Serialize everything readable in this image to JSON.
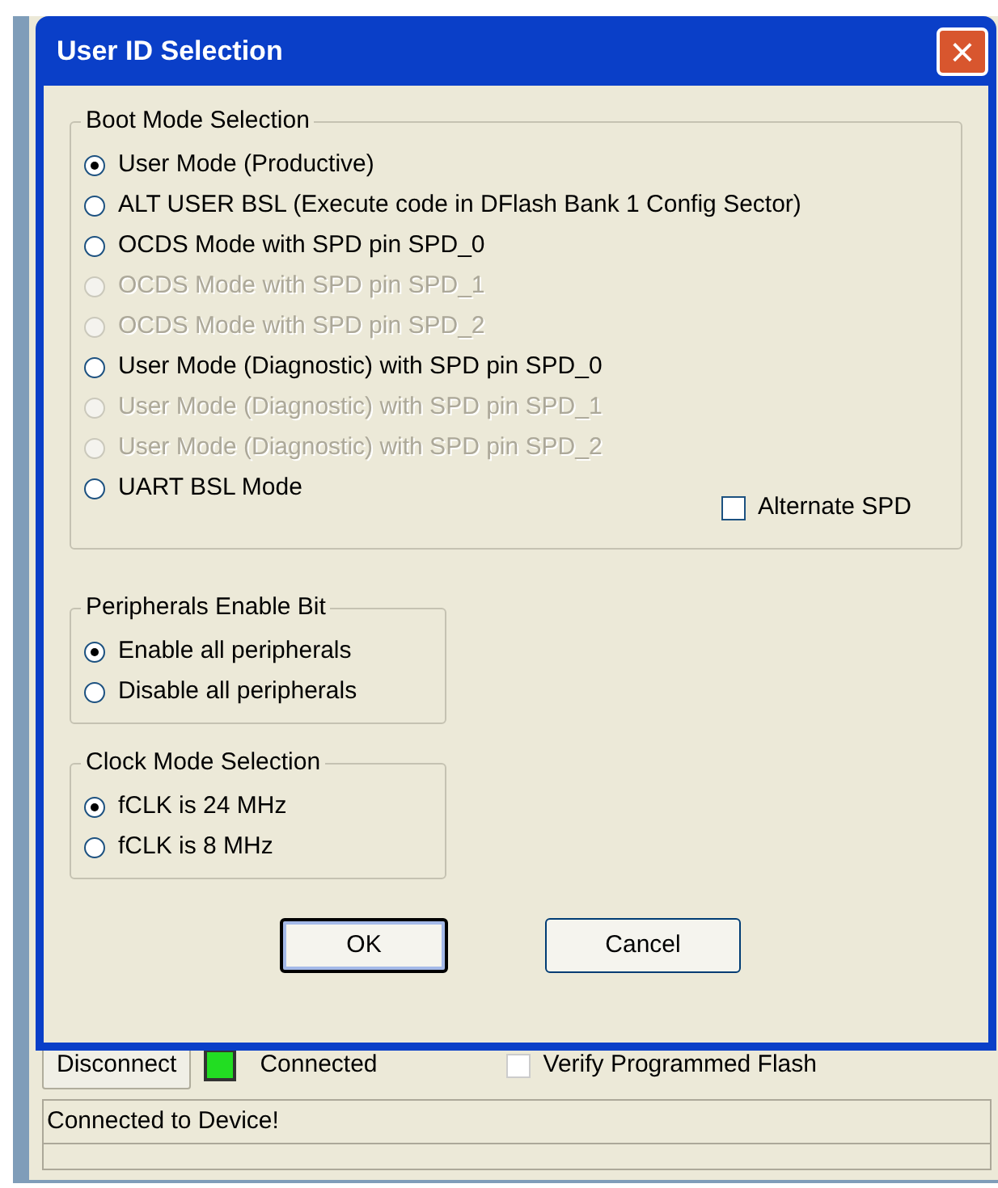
{
  "dialog": {
    "title": "User ID Selection",
    "close": "×"
  },
  "boot_mode": {
    "title": "Boot Mode Selection",
    "options": [
      {
        "label": "User Mode (Productive)",
        "selected": true,
        "disabled": false
      },
      {
        "label": "ALT USER BSL (Execute code in DFlash Bank 1 Config Sector)",
        "selected": false,
        "disabled": false
      },
      {
        "label": "OCDS Mode with SPD pin SPD_0",
        "selected": false,
        "disabled": false
      },
      {
        "label": "OCDS Mode with SPD pin SPD_1",
        "selected": false,
        "disabled": true
      },
      {
        "label": "OCDS Mode with SPD pin SPD_2",
        "selected": false,
        "disabled": true
      },
      {
        "label": "User Mode (Diagnostic) with SPD pin SPD_0",
        "selected": false,
        "disabled": false
      },
      {
        "label": "User Mode (Diagnostic) with SPD pin SPD_1",
        "selected": false,
        "disabled": true
      },
      {
        "label": "User Mode (Diagnostic) with SPD pin SPD_2",
        "selected": false,
        "disabled": true
      },
      {
        "label": "UART BSL Mode",
        "selected": false,
        "disabled": false
      }
    ],
    "alternate_spd": {
      "label": "Alternate SPD",
      "checked": false
    }
  },
  "peripherals": {
    "title": "Peripherals Enable Bit",
    "options": [
      {
        "label": "Enable all peripherals",
        "selected": true,
        "disabled": false
      },
      {
        "label": "Disable all peripherals",
        "selected": false,
        "disabled": false
      }
    ]
  },
  "clock_mode": {
    "title": "Clock Mode Selection",
    "options": [
      {
        "label": "fCLK is 24 MHz",
        "selected": true,
        "disabled": false
      },
      {
        "label": "fCLK is 8 MHz",
        "selected": false,
        "disabled": false
      }
    ]
  },
  "buttons": [
    {
      "label": "OK",
      "default": true
    },
    {
      "label": "Cancel",
      "default": false
    }
  ],
  "background": {
    "disconnect": "Disconnect",
    "indicator": {
      "color": "#22dd22"
    },
    "connection_label": "Connected",
    "verify": {
      "label": "Verify Programmed Flash",
      "checked": false
    },
    "status_bar": "Connected to Device!"
  }
}
